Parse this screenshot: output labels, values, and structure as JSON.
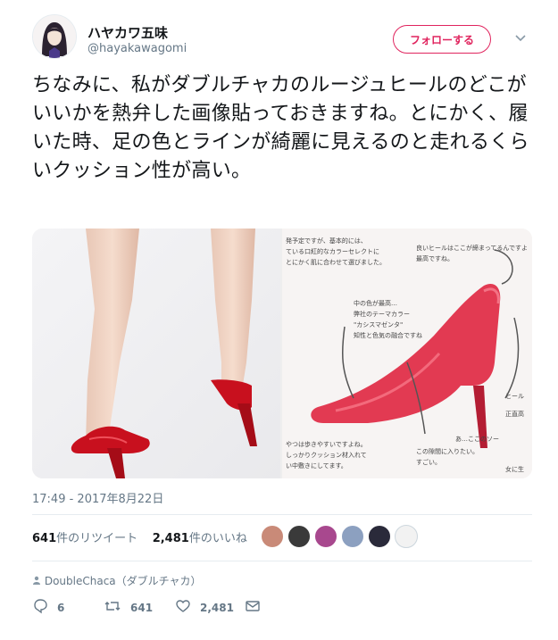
{
  "user": {
    "display_name": "ハヤカワ五味",
    "handle": "@hayakawagomi"
  },
  "follow_button": {
    "label": "フォローする"
  },
  "tweet": {
    "text": "ちなみに、私がダブルチャカのルージュヒールのどこがいいかを熱弁した画像貼っておきますね。とにかく、履いた時、足の色とラインが綺麗に見えるのと走れるくらいクッション性が高い。"
  },
  "media": {
    "annotations": [
      "発予定ですが、基本的には、",
      "ている口紅的なカラーセレクトに",
      "とにかく肌に合わせて選びました。",
      "良いヒールはここが締まってるんですよ",
      "最高ですね。",
      "中の色が最高…",
      "弊社のテーマカラー",
      "\"カシスマゼンタ\"",
      "知性と色気の融合ですね",
      "あ…ここのソー",
      "この隙間に入りたい。",
      "すごい。",
      "やつは歩きやすいですよね。",
      "しっかりクッション材入れて",
      "い中敷きにしてます。",
      "正直高",
      "ヒール",
      "女に生"
    ]
  },
  "timestamp": "17:49 - 2017年8月22日",
  "stats": {
    "retweets_count": "641",
    "retweets_label": "件のリツイート",
    "likes_count": "2,481",
    "likes_label": "件のいいね"
  },
  "via": "DoubleChaca（ダブルチャカ）",
  "actions": {
    "reply_count": "6",
    "retweet_count": "641",
    "like_count": "2,481"
  },
  "colors": {
    "accent": "#e0245e",
    "muted": "#657786",
    "text": "#14171a",
    "shoe_red": "#d81f2f"
  }
}
